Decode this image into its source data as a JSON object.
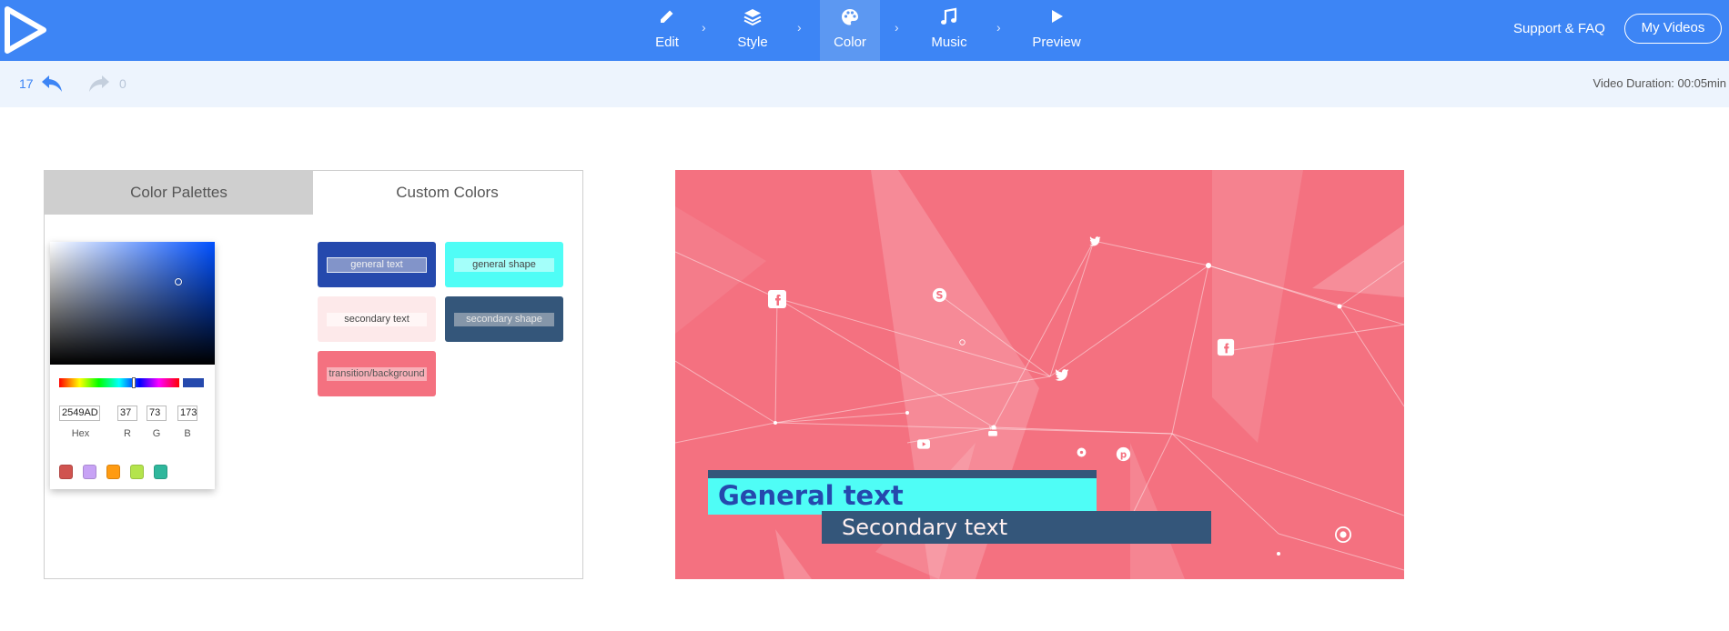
{
  "nav": {
    "logo": "play-logo",
    "steps": [
      {
        "label": "Edit",
        "icon": "pencil-icon"
      },
      {
        "label": "Style",
        "icon": "layers-icon"
      },
      {
        "label": "Color",
        "icon": "palette-icon",
        "active": true
      },
      {
        "label": "Music",
        "icon": "music-note-icon"
      },
      {
        "label": "Preview",
        "icon": "play-icon"
      }
    ],
    "support": "Support & FAQ",
    "my_videos": "My Videos"
  },
  "history": {
    "undo_count": "17",
    "redo_count": "0",
    "duration": "Video Duration: 00:05min"
  },
  "panel": {
    "tabs": [
      {
        "label": "Color Palettes",
        "selected": false
      },
      {
        "label": "Custom Colors",
        "selected": true
      }
    ],
    "picker": {
      "hex": "2549AD",
      "r": "37",
      "g": "73",
      "b": "173",
      "hex_label": "Hex",
      "r_label": "R",
      "g_label": "G",
      "b_label": "B",
      "current_color": "#2549ad",
      "presets": [
        "#d0534f",
        "#c7a2f5",
        "#ff9b11",
        "#b4e44c",
        "#2fb79c"
      ]
    },
    "color_items": [
      {
        "label": "general text",
        "color": "#2549ad"
      },
      {
        "label": "general shape",
        "color": "#4ffdf6"
      },
      {
        "label": "secondary text",
        "color": "#fde9ea"
      },
      {
        "label": "secondary shape",
        "color": "#34567a"
      },
      {
        "label": "transition/background",
        "color": "#f47180"
      }
    ]
  },
  "preview": {
    "general_text": "General text",
    "secondary_text": "Secondary text",
    "background": "#f47180",
    "icons": [
      "facebook-icon",
      "skype-icon",
      "twitter-icon",
      "youtube-icon",
      "pinterest-icon",
      "instagram-icon"
    ]
  }
}
